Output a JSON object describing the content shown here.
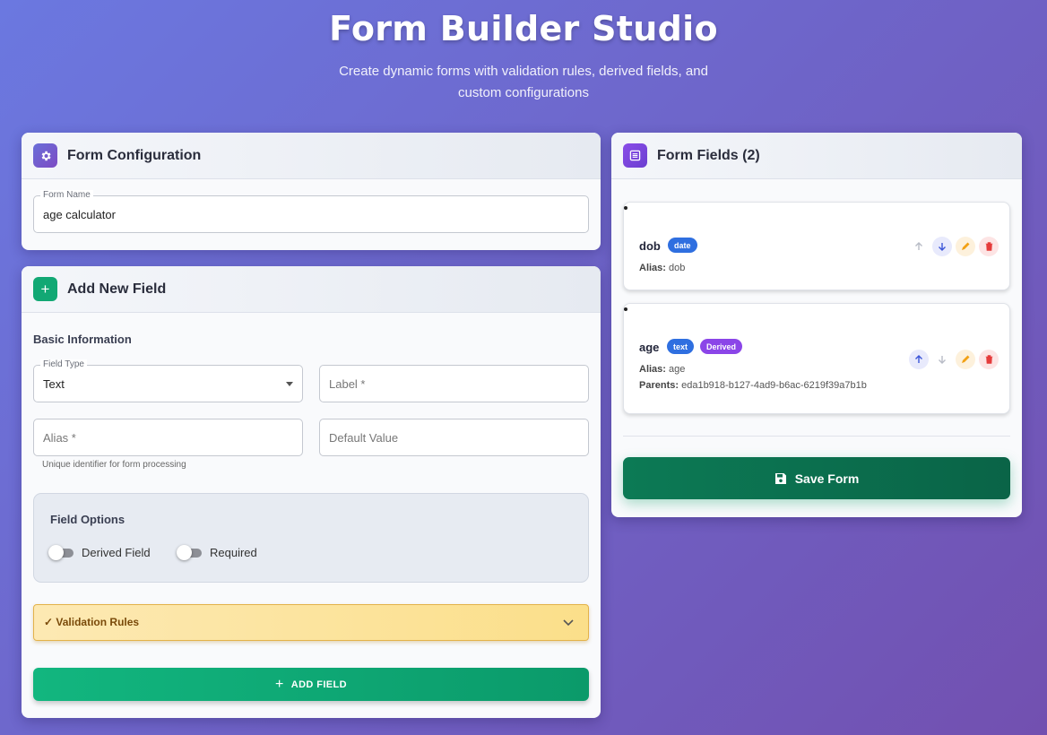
{
  "header": {
    "title": "Form Builder Studio",
    "subtitle": "Create dynamic forms with validation rules, derived fields, and custom configurations"
  },
  "form_config": {
    "title": "Form Configuration",
    "icon": "gear-icon",
    "form_name_label": "Form Name",
    "form_name_value": "age calculator"
  },
  "add_field": {
    "title": "Add New Field",
    "icon": "plus-icon",
    "basic_info_label": "Basic Information",
    "field_type_label": "Field Type",
    "field_type_value": "Text",
    "label_placeholder": "Label *",
    "alias_placeholder": "Alias *",
    "alias_helper": "Unique identifier for form processing",
    "default_value_placeholder": "Default Value",
    "options_title": "Field Options",
    "derived_toggle_label": "Derived Field",
    "derived_toggle_on": false,
    "required_toggle_label": "Required",
    "required_toggle_on": false,
    "validation_label": "✓ Validation Rules",
    "add_button_label": "ADD FIELD"
  },
  "form_fields": {
    "title": "Form Fields (2)",
    "icon": "list-icon",
    "items": [
      {
        "name": "dob",
        "type_badge": "date",
        "alias_label": "Alias:",
        "alias_value": "dob"
      },
      {
        "name": "age",
        "type_badge": "text",
        "derived_badge": "Derived",
        "alias_label": "Alias:",
        "alias_value": "age",
        "parents_label": "Parents:",
        "parents_value": "eda1b918-b127-4ad9-b6ac-6219f39a7b1b"
      }
    ],
    "save_button_label": "Save Form"
  },
  "colors": {
    "accent_purple": "#7b4fe0",
    "accent_green": "#0f9f6e",
    "badge_blue": "#2f6fe0",
    "badge_purple": "#8b45e8",
    "warning_yellow": "#fbdf8a",
    "delete_red": "#e53b3b",
    "edit_orange": "#f2a115"
  }
}
